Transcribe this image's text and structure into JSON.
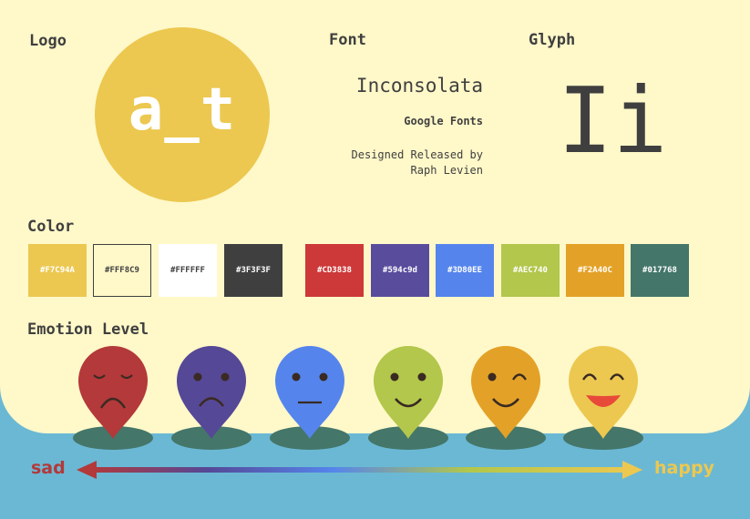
{
  "sections": {
    "logo": "Logo",
    "font": "Font",
    "glyph": "Glyph",
    "color": "Color",
    "emotion": "Emotion Level"
  },
  "logo": {
    "text": "a_t",
    "color": "#ecc850"
  },
  "font": {
    "name": "Inconsolata",
    "source": "Google Fonts",
    "credit_line1": "Designed Released by",
    "credit_line2": "Raph Levien"
  },
  "glyph": {
    "text": "Ii"
  },
  "colors": [
    {
      "label": "#F7C94A",
      "bg": "#ecc850",
      "fg": "#ffffff"
    },
    {
      "label": "#FFF8C9",
      "bg": "#fff8c9",
      "fg": "#3f3f3f",
      "border": "#3f3f3f"
    },
    {
      "label": "#FFFFFF",
      "bg": "#ffffff",
      "fg": "#3f3f3f"
    },
    {
      "label": "#3F3F3F",
      "bg": "#3f3f3f",
      "fg": "#ffffff"
    },
    {
      "label": "#CD3838",
      "bg": "#cd3838",
      "fg": "#ffffff"
    },
    {
      "label": "#594c9d",
      "bg": "#594c9d",
      "fg": "#ffffff"
    },
    {
      "label": "#3D80EE",
      "bg": "#5585ec",
      "fg": "#ffffff"
    },
    {
      "label": "#AEC740",
      "bg": "#b2c74b",
      "fg": "#ffffff"
    },
    {
      "label": "#F2A40C",
      "bg": "#e3a227",
      "fg": "#ffffff"
    },
    {
      "label": "#017768",
      "bg": "#44766a",
      "fg": "#ffffff"
    }
  ],
  "emotions": [
    {
      "name": "sad-face",
      "color": "#b3393a",
      "expression": "sad-closed"
    },
    {
      "name": "unhappy-face",
      "color": "#554896",
      "expression": "sad"
    },
    {
      "name": "neutral-face",
      "color": "#5585ec",
      "expression": "neutral"
    },
    {
      "name": "smile-face",
      "color": "#b2c74b",
      "expression": "smile"
    },
    {
      "name": "wink-face",
      "color": "#e3a227",
      "expression": "wink"
    },
    {
      "name": "happy-face",
      "color": "#ecc850",
      "expression": "laugh"
    }
  ],
  "scale": {
    "sad_label": "sad",
    "happy_label": "happy",
    "sad_color": "#b3393a",
    "happy_color": "#ecc850"
  }
}
